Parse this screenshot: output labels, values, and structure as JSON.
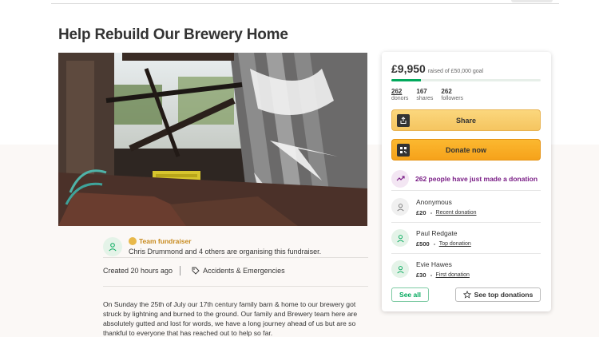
{
  "page": {
    "title": "Help Rebuild Our Brewery Home"
  },
  "organiser": {
    "team_label": "Team fundraiser",
    "text": "Chris Drummond and 4 others are organising this fundraiser."
  },
  "meta": {
    "created": "Created 20 hours ago",
    "category": "Accidents & Emergencies"
  },
  "story": {
    "text": "On Sunday the 25th of July our 17th century family barn & home to our brewery got struck by lightning and burned to the ground. Our family and Brewery team here are absolutely gutted and lost for words, we have a long journey ahead of us but are so thankful to everyone that has reached out to help so far."
  },
  "donation_card": {
    "amount": "£9,950",
    "goal_text": "raised of £50,000 goal",
    "progress_fraction": 0.199,
    "stats": [
      {
        "num": "262",
        "label": "donors"
      },
      {
        "num": "167",
        "label": "shares"
      },
      {
        "num": "262",
        "label": "followers"
      }
    ],
    "share_label": "Share",
    "donate_label": "Donate now",
    "recent_activity": "262 people have just made a donation",
    "donations": [
      {
        "name": "Anonymous",
        "amount": "£20",
        "tag": "Recent donation"
      },
      {
        "name": "Paul Redgate",
        "amount": "£500",
        "tag": "Top donation"
      },
      {
        "name": "Evie Hawes",
        "amount": "£30",
        "tag": "First donation"
      }
    ],
    "see_all_label": "See all",
    "see_top_label": "See top donations"
  },
  "colors": {
    "brand_green": "#02a95c",
    "share_yellow": "#f5c560",
    "donate_orange": "#f6a21a",
    "activity_purple": "#7a1e86"
  }
}
